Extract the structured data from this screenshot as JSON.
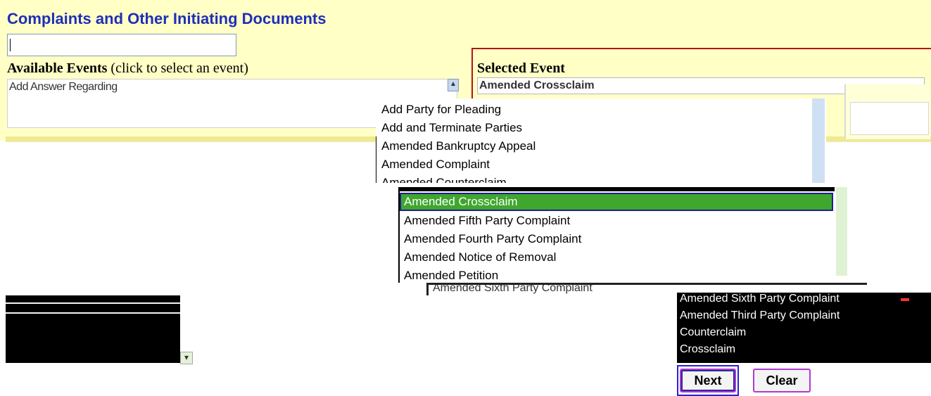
{
  "page": {
    "title": "Complaints and Other Initiating Documents"
  },
  "search": {
    "value": "",
    "placeholder": ""
  },
  "available_events": {
    "label_bold": "Available Events",
    "label_rest": " (click to select an event)",
    "first_visible": "Add Answer Regarding"
  },
  "selected_event": {
    "label": "Selected Event",
    "value": "Amended Crossclaim"
  },
  "dropdown_primary": {
    "options": [
      "Add Party for Pleading",
      "Add and Terminate Parties",
      "Amended Bankruptcy Appeal",
      "Amended Complaint",
      "Amended Counterclaim"
    ]
  },
  "dropdown_secondary": {
    "selected": "Amended Crossclaim",
    "options": [
      "Amended Fifth Party Complaint",
      "Amended Fourth Party Complaint",
      "Amended Notice of Removal",
      "Amended Petition"
    ]
  },
  "strip_3": {
    "text": "Amended Sixth Party Complaint"
  },
  "bottom_list": {
    "items": [
      "Amended Sixth Party Complaint",
      "Amended Third Party Complaint",
      "Counterclaim",
      "Crossclaim"
    ]
  },
  "buttons": {
    "next": "Next",
    "clear": "Clear"
  },
  "icons": {
    "scroll_up": "▲",
    "select_arrow": "▾"
  }
}
